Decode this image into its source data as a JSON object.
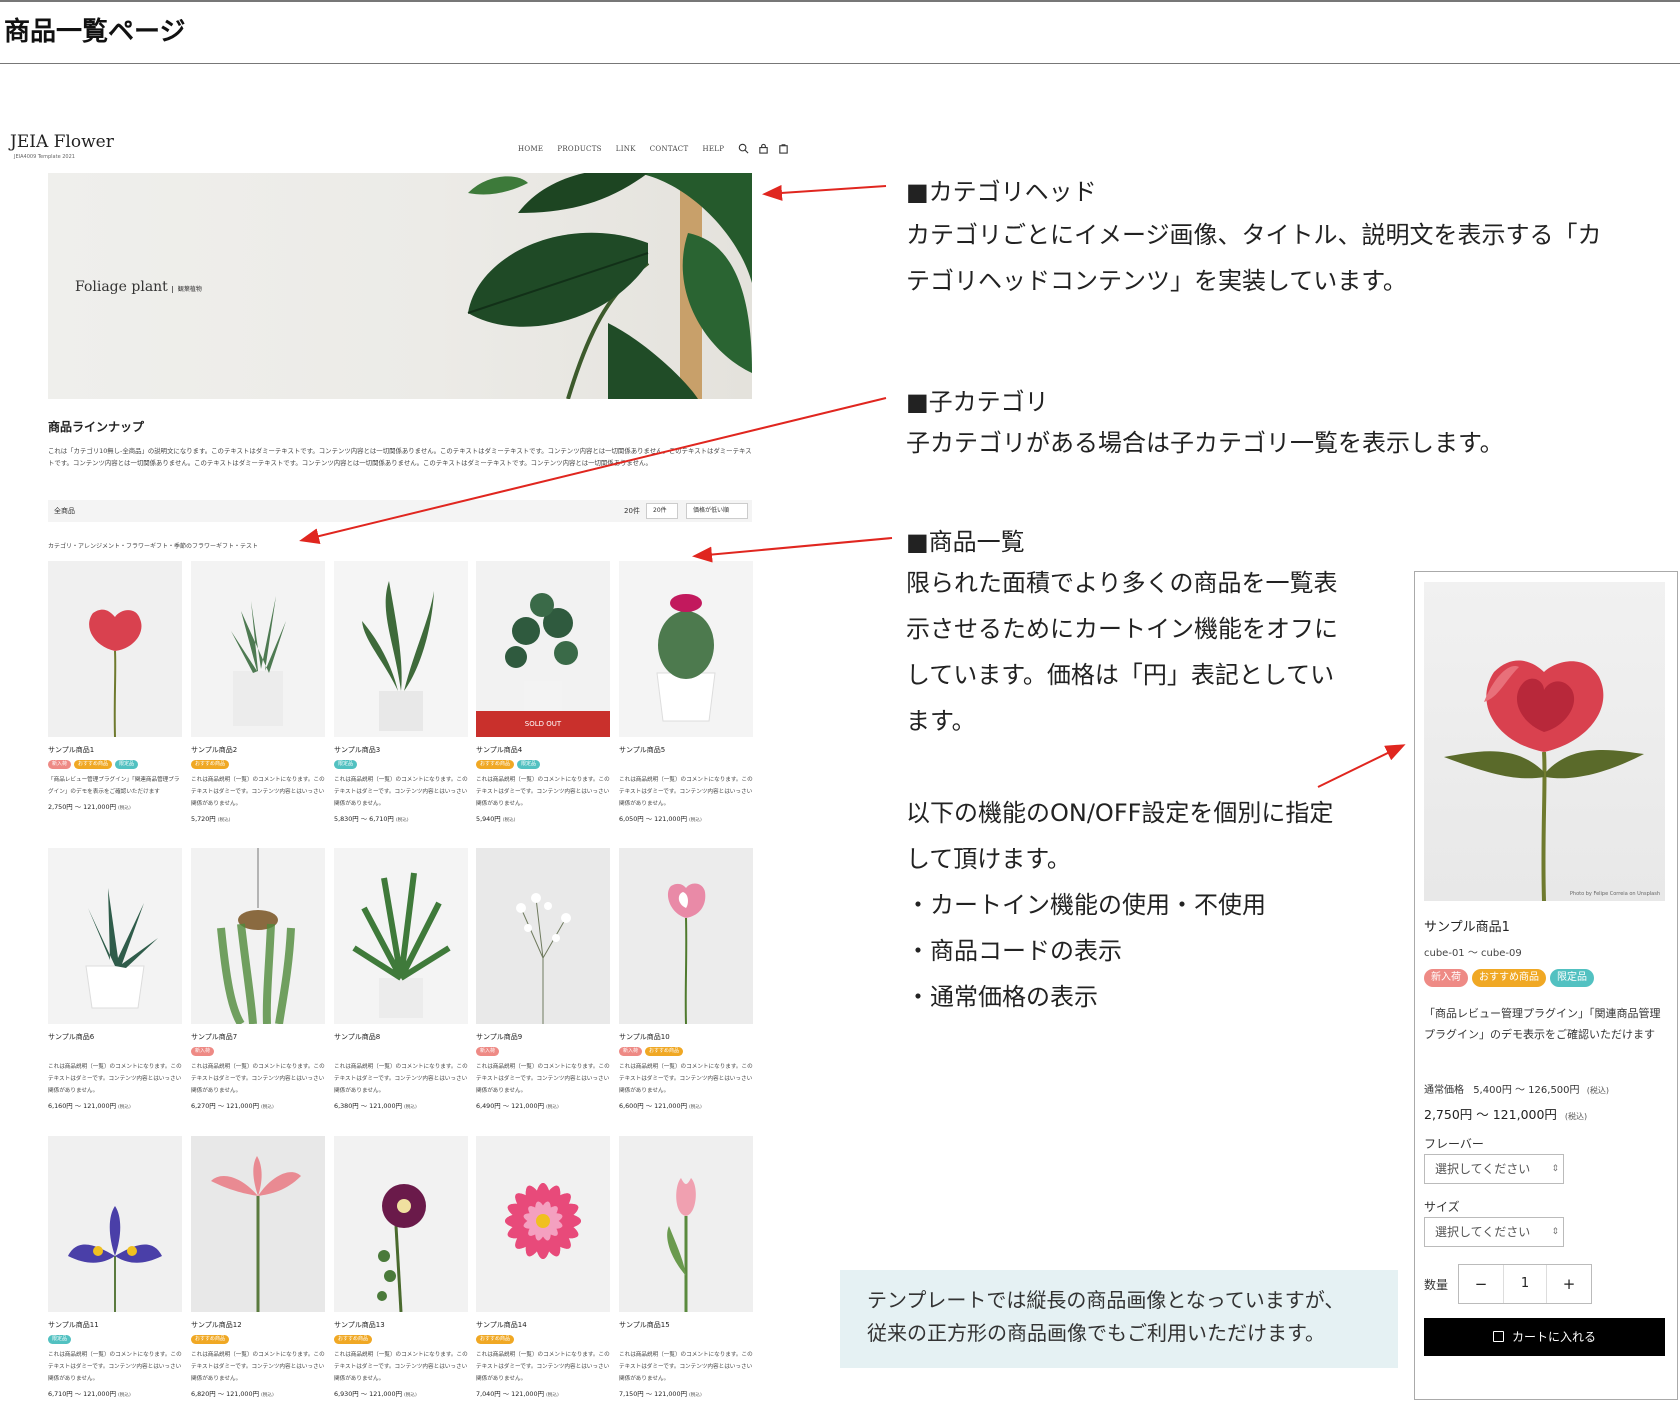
{
  "page_title": "商品一覧ページ",
  "site": {
    "logo": "JEIA Flower",
    "logo_sub": "JEIA4009 Template 2021",
    "nav": [
      "HOME",
      "PRODUCTS",
      "LINK",
      "CONTACT",
      "HELP"
    ],
    "icons": [
      "search-icon",
      "user-icon",
      "cart-icon"
    ]
  },
  "hero": {
    "title": "Foliage plant",
    "subtitle": "観葉植物"
  },
  "lineup": {
    "title": "商品ラインナップ",
    "desc": "これは「カテゴリ10無し-全商品」の説明文になります。このテキストはダミーテキストです。コンテンツ内容とは一切関係ありません。このテキストはダミーテキストです。コンテンツ内容とは一切関係ありません。このテキストはダミーテキストです。コンテンツ内容とは一切関係ありません。このテキストはダミーテキストです。コンテンツ内容とは一切関係ありません。このテキストはダミーテキストです。コンテンツ内容とは一切関係ありません。"
  },
  "toolbar": {
    "all": "全商品",
    "count": "20件",
    "per_page": "20件",
    "sort": "価格が低い順"
  },
  "breadcrumb": "カテゴリ・アレンジメント・フラワーギフト・季節のフラワーギフト・テスト",
  "products": [
    {
      "name": "サンプル商品1",
      "badges": [
        "新入荷",
        "おすすめ商品",
        "限定品"
      ],
      "desc": "「商品レビュー管理プラグイン」「関連商品管理プラグイン」のデモを表示をご確認いただけます",
      "price": "2,750円 ～ 121,000円",
      "tax": "(税込)"
    },
    {
      "name": "サンプル商品2",
      "badges": [
        "おすすめ商品"
      ],
      "desc": "これは商品説明（一覧）のコメントになります。このテキストはダミーです。コンテンツ内容とはいっさい関係がありません。",
      "price": "5,720円",
      "tax": "(税込)"
    },
    {
      "name": "サンプル商品3",
      "badges": [
        "限定品"
      ],
      "desc": "これは商品説明（一覧）のコメントになります。このテキストはダミーです。コンテンツ内容とはいっさい関係がありません。",
      "price": "5,830円 ～ 6,710円",
      "tax": "(税込)"
    },
    {
      "name": "サンプル商品4",
      "badges": [
        "おすすめ商品",
        "限定品"
      ],
      "desc": "これは商品説明（一覧）のコメントになります。このテキストはダミーです。コンテンツ内容とはいっさい関係がありません。",
      "price": "5,940円",
      "tax": "(税込)",
      "sold_out": "SOLD OUT"
    },
    {
      "name": "サンプル商品5",
      "badges": [],
      "desc": "これは商品説明（一覧）のコメントになります。このテキストはダミーです。コンテンツ内容とはいっさい関係がありません。",
      "price": "6,050円 ～ 121,000円",
      "tax": "(税込)"
    },
    {
      "name": "サンプル商品6",
      "badges": [],
      "desc": "これは商品説明（一覧）のコメントになります。このテキストはダミーです。コンテンツ内容とはいっさい関係がありません。",
      "price": "6,160円 ～ 121,000円",
      "tax": "(税込)"
    },
    {
      "name": "サンプル商品7",
      "badges": [
        "新入荷"
      ],
      "desc": "これは商品説明（一覧）のコメントになります。このテキストはダミーです。コンテンツ内容とはいっさい関係がありません。",
      "price": "6,270円 ～ 121,000円",
      "tax": "(税込)"
    },
    {
      "name": "サンプル商品8",
      "badges": [],
      "desc": "これは商品説明（一覧）のコメントになります。このテキストはダミーです。コンテンツ内容とはいっさい関係がありません。",
      "price": "6,380円 ～ 121,000円",
      "tax": "(税込)"
    },
    {
      "name": "サンプル商品9",
      "badges": [
        "新入荷"
      ],
      "desc": "これは商品説明（一覧）のコメントになります。このテキストはダミーです。コンテンツ内容とはいっさい関係がありません。",
      "price": "6,490円 ～ 121,000円",
      "tax": "(税込)"
    },
    {
      "name": "サンプル商品10",
      "badges": [
        "新入荷",
        "おすすめ商品"
      ],
      "desc": "これは商品説明（一覧）のコメントになります。このテキストはダミーです。コンテンツ内容とはいっさい関係がありません。",
      "price": "6,600円 ～ 121,000円",
      "tax": "(税込)"
    },
    {
      "name": "サンプル商品11",
      "badges": [
        "限定品"
      ],
      "desc": "これは商品説明（一覧）のコメントになります。このテキストはダミーです。コンテンツ内容とはいっさい関係がありません。",
      "price": "6,710円 ～ 121,000円",
      "tax": "(税込)"
    },
    {
      "name": "サンプル商品12",
      "badges": [
        "おすすめ商品"
      ],
      "desc": "これは商品説明（一覧）のコメントになります。このテキストはダミーです。コンテンツ内容とはいっさい関係がありません。",
      "price": "6,820円 ～ 121,000円",
      "tax": "(税込)"
    },
    {
      "name": "サンプル商品13",
      "badges": [
        "おすすめ商品"
      ],
      "desc": "これは商品説明（一覧）のコメントになります。このテキストはダミーです。コンテンツ内容とはいっさい関係がありません。",
      "price": "6,930円 ～ 121,000円",
      "tax": "(税込)"
    },
    {
      "name": "サンプル商品14",
      "badges": [
        "おすすめ商品"
      ],
      "desc": "これは商品説明（一覧）のコメントになります。このテキストはダミーです。コンテンツ内容とはいっさい関係がありません。",
      "price": "7,040円 ～ 121,000円",
      "tax": "(税込)"
    },
    {
      "name": "サンプル商品15",
      "badges": [],
      "desc": "これは商品説明（一覧）のコメントになります。このテキストはダミーです。コンテンツ内容とはいっさい関係がありません。",
      "price": "7,150円 ～ 121,000円",
      "tax": "(税込)"
    }
  ],
  "annotations": {
    "category_head": {
      "title": "■カテゴリヘッド",
      "lines": [
        "カテゴリごとにイメージ画像、タイトル、説明文を表示する「カ",
        "テゴリヘッドコンテンツ」を実装しています。"
      ]
    },
    "child_category": {
      "title": "■子カテゴリ",
      "lines": [
        "子カテゴリがある場合は子カテゴリ一覧を表示します。"
      ]
    },
    "product_list": {
      "title": "■商品一覧",
      "lines": [
        "限られた面積でより多くの商品を一覧表",
        "示させるためにカートイン機能をオフに",
        "しています。価格は「円」表記としてい",
        "ます。"
      ]
    },
    "settings": {
      "lines": [
        "以下の機能のON/OFF設定を個別に指定",
        "して頂けます。",
        "・カートイン機能の使用・不使用",
        "・商品コードの表示",
        "・通常価格の表示"
      ]
    },
    "note": [
      "テンプレートでは縦長の商品画像となっていますが、",
      "従来の正方形の商品画像でもご利用いただけます。"
    ]
  },
  "detail": {
    "name": "サンプル商品1",
    "code": "cube-01 ～ cube-09",
    "badges": [
      "新入荷",
      "おすすめ商品",
      "限定品"
    ],
    "desc": "「商品レビュー管理プラグイン」「関連商品管理プラグイン」のデモ表示をご確認いただけます",
    "normal_label": "通常価格",
    "normal_price": "5,400円 ～ 126,500円",
    "price": "2,750円 ～ 121,000円",
    "tax": "(税込)",
    "flavor_label": "フレーバー",
    "size_label": "サイズ",
    "select_placeholder": "選択してください",
    "qty_label": "数量",
    "qty_value": "1",
    "minus": "−",
    "plus": "+",
    "cart_button": "カートに入れる",
    "photo_credit": "Photo by Felipe Correia on Unsplash"
  },
  "colors": {
    "new": "#ee8a85",
    "recommend": "#f0a824",
    "limited": "#52c1c1",
    "sold_out": "#c9302c",
    "arrow": "#e0261f",
    "note_bg": "#e5f1f3"
  }
}
